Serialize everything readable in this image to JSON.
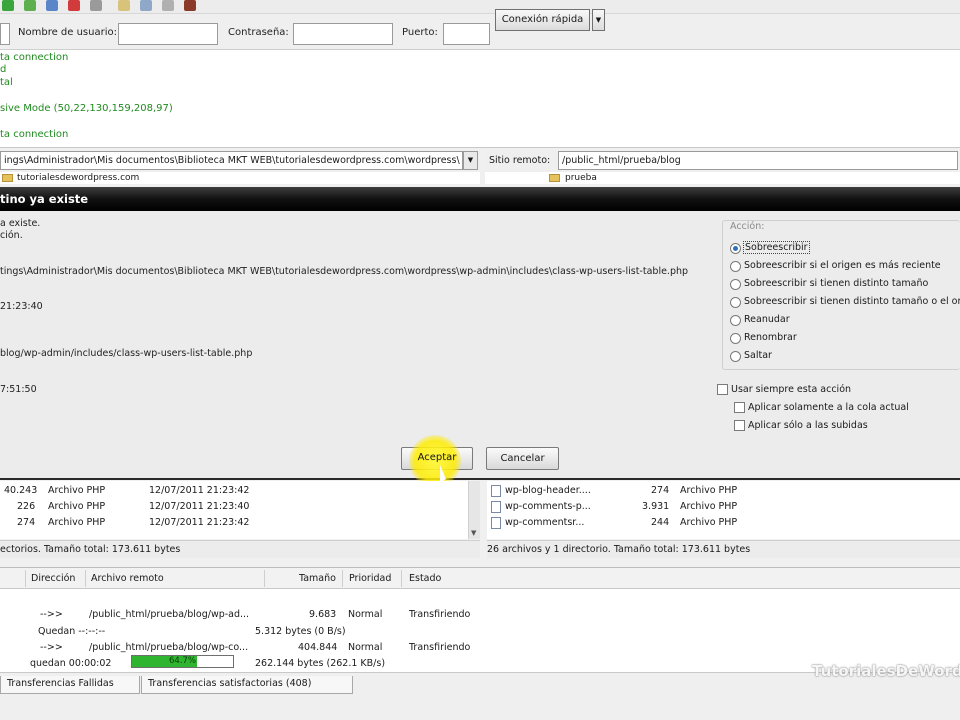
{
  "toolbar": {
    "icons": [
      "green-arrow-icon",
      "green-arrow-icon",
      "blue-sync-icon",
      "red-cancel-icon",
      "disconnect-icon",
      "filter-icon",
      "compare-icon",
      "search-icon",
      "binoculars-icon"
    ]
  },
  "quickconnect": {
    "username_label": "Nombre de usuario:",
    "password_label": "Contraseña:",
    "port_label": "Puerto:",
    "button_label": "Conexión rápida",
    "dropdown_glyph": "▼"
  },
  "log": {
    "lines": [
      "ta connection",
      "d",
      "tal",
      "sive Mode (50,22,130,159,208,97)",
      "ta connection"
    ]
  },
  "local": {
    "path": "ings\\Administrador\\Mis documentos\\Biblioteca MKT WEB\\tutorialesdewordpress.com\\wordpress\\",
    "tree_item": "tutorialesdewordpress.com",
    "dropdown_glyph": "▼",
    "files": [
      {
        "size": "40.243",
        "type": "Archivo PHP",
        "date": "12/07/2011 21:23:42"
      },
      {
        "size": "226",
        "type": "Archivo PHP",
        "date": "12/07/2011 21:23:40"
      },
      {
        "size": "274",
        "type": "Archivo PHP",
        "date": "12/07/2011 21:23:42"
      }
    ],
    "status": "ectorios. Tamaño total: 173.611 bytes"
  },
  "remote": {
    "label": "Sitio remoto:",
    "path": "/public_html/prueba/blog",
    "tree_item": "prueba",
    "files": [
      {
        "name": "wp-blog-header....",
        "size": "274",
        "type": "Archivo PHP"
      },
      {
        "name": "wp-comments-p...",
        "size": "3.931",
        "type": "Archivo PHP"
      },
      {
        "name": "wp-commentsr...",
        "size": "244",
        "type": "Archivo PHP"
      }
    ],
    "status": "26 archivos y 1 directorio. Tamaño total: 173.611 bytes"
  },
  "dialog": {
    "title": "tino ya existe",
    "lines": [
      "a existe.",
      "ción.",
      "tings\\Administrador\\Mis documentos\\Biblioteca MKT WEB\\tutorialesdewordpress.com\\wordpress\\wp-admin\\includes\\class-wp-users-list-table.php",
      "21:23:40",
      "blog/wp-admin/includes/class-wp-users-list-table.php",
      "7:51:50"
    ],
    "action_title": "Acción:",
    "options": [
      {
        "label": "Sobreescribir",
        "selected": true
      },
      {
        "label": "Sobreescribir si el origen es más reciente",
        "selected": false
      },
      {
        "label": "Sobreescribir si tienen distinto tamaño",
        "selected": false
      },
      {
        "label": "Sobreescribir si tienen distinto tamaño o el ori",
        "selected": false
      },
      {
        "label": "Reanudar",
        "selected": false
      },
      {
        "label": "Renombrar",
        "selected": false
      },
      {
        "label": "Saltar",
        "selected": false
      }
    ],
    "always_label": "Usar siempre esta acción",
    "current_queue_label": "Aplicar solamente a la cola actual",
    "uploads_label": "Aplicar sólo a las subidas",
    "ok_label": "Aceptar",
    "cancel_label": "Cancelar"
  },
  "queue": {
    "headers": [
      "Dirección",
      "Archivo remoto",
      "Tamaño",
      "Prioridad",
      "Estado"
    ],
    "rows": [
      {
        "direction": "-->>",
        "remote": "/public_html/prueba/blog/wp-ad...",
        "size": "9.683",
        "priority": "Normal",
        "status": "Transfiriendo"
      },
      {
        "left": "Quedan --:--:--",
        "transferred": "5.312 bytes (0 B/s)"
      },
      {
        "direction": "-->>",
        "remote": "/public_html/prueba/blog/wp-co...",
        "size": "404.844",
        "priority": "Normal",
        "status": "Transfiriendo"
      },
      {
        "left": "quedan 00:00:02",
        "transferred": "262.144 bytes (262.1 KB/s)"
      }
    ],
    "progress_percent": 64,
    "progress_text": "64.7%"
  },
  "tabs": {
    "failed": "Transferencias Fallidas",
    "successful": "Transferencias satisfactorias (408)"
  },
  "watermark": "TutorialesDeWord",
  "colors": {
    "log_green": "#1f8a1f",
    "dialog_title_bg": "#111111",
    "highlight": "#ffee00",
    "progress": "#2fb52f"
  }
}
